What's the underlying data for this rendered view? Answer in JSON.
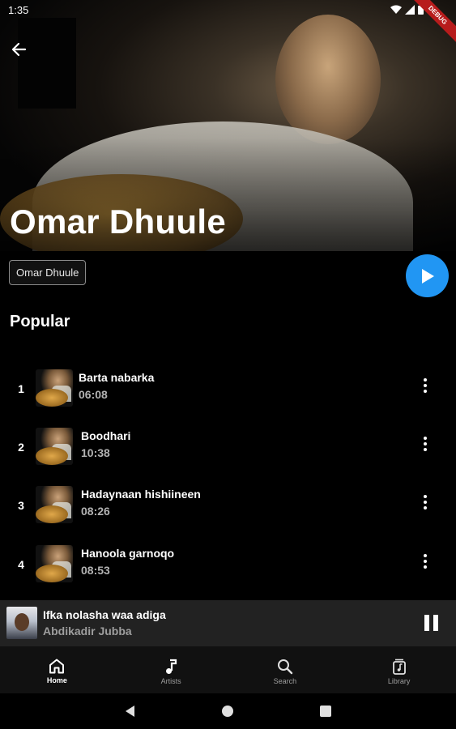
{
  "status_bar": {
    "time": "1:35",
    "debug_label": "DEBUG"
  },
  "artist": {
    "name": "Omar Dhuule",
    "chip_label": "Omar Dhuule"
  },
  "section": {
    "title": "Popular"
  },
  "tracks": [
    {
      "number": "1",
      "title": "Barta nabarka",
      "duration": "06:08"
    },
    {
      "number": "2",
      "title": "Boodhari",
      "duration": "10:38"
    },
    {
      "number": "3",
      "title": "Hadaynaan hishiineen",
      "duration": "08:26"
    },
    {
      "number": "4",
      "title": "Hanoola garnoqo",
      "duration": "08:53"
    }
  ],
  "now_playing": {
    "title": "Ifka nolasha waa adiga",
    "artist": "Abdikadir Jubba"
  },
  "bottom_nav": {
    "items": [
      {
        "label": "Home",
        "icon": "home-icon",
        "active": true
      },
      {
        "label": "Artists",
        "icon": "music-note-icon",
        "active": false
      },
      {
        "label": "Search",
        "icon": "search-icon",
        "active": false
      },
      {
        "label": "Library",
        "icon": "library-icon",
        "active": false
      }
    ]
  },
  "colors": {
    "accent": "#2196f3",
    "background": "#000000",
    "mini_player_bg": "#222222",
    "nav_bg": "#111111"
  }
}
